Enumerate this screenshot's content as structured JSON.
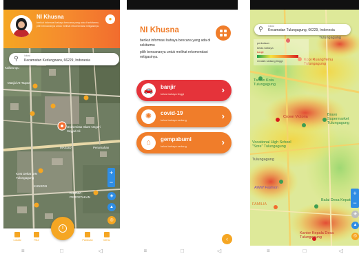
{
  "screen1": {
    "user_name": "NI Khusna",
    "description": "berikut informasi bahaya bencana yang ada di sekitarmu. pilih bencananya untuk melihat rekomendasi mitigasinya.",
    "search_label": "lokasi",
    "search_value": "Kecamatan Kedungwaru, 66229, Indonesia",
    "map_labels": [
      "Masjid At-Taqwa",
      "Universitas Islam Negeri Sayyid Ali",
      "MASJID",
      "Perumahan",
      "Kost Dekat UIN Tulungagung",
      "KUNSDN",
      "KURNIA",
      "PERCETAKAN"
    ],
    "tabs": [
      "Lokasi",
      "Fitur",
      "",
      "Panduan",
      "Menu"
    ],
    "colors": {
      "accent": "#f5a623",
      "accent_dark": "#f26c2e",
      "map_control": "#2f8de4"
    }
  },
  "screen2": {
    "user_name": "NI Khusna",
    "intro_line": "berikut informasi bahaya bencana yang ada di sekitarmu",
    "instruction_line": "pilih bencananya untuk melihat rekomendasi mitigasinya.",
    "hazards": [
      {
        "name": "banjir",
        "level": "kelas bahaya tinggi",
        "color": "#e5333a",
        "icon": "car-flood-icon"
      },
      {
        "name": "covid-19",
        "level": "kelas bahaya sedang",
        "color": "#f07d2a",
        "icon": "virus-icon"
      },
      {
        "name": "gempabumi",
        "level": "kelas bahaya sedang",
        "color": "#f07d2a",
        "icon": "earthquake-icon"
      }
    ]
  },
  "screen3": {
    "search_label": "lokasi",
    "search_value": "Kecamatan Tulungagung, 66229, Indonesia",
    "legend_title": "perkotaan",
    "legend_subtitle": "kelas bahaya",
    "legend_hazard": "banjir",
    "legend_scale": "rendah sedang tinggi",
    "map_labels": [
      "Tulungagung",
      "Kopi RuangTemu Tulungagung",
      "Taman Kota Tulungagung",
      "Crown Victoria",
      "Bravo Supermarket Tulungagung",
      "Vocational High School \"Sore\" Tulungagung",
      "Tulungagung",
      "AWW Fashion",
      "Balai Desa Kepatihan",
      "FAMILIA",
      "Kantor Kepala Desa Tulungagung"
    ]
  }
}
